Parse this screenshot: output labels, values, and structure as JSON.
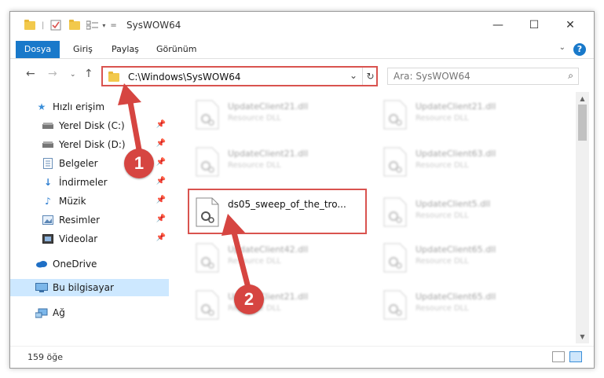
{
  "window": {
    "title": "SysWOW64"
  },
  "ribbon": {
    "file_tab": "Dosya",
    "tabs": [
      "Giriş",
      "Paylaş",
      "Görünüm"
    ],
    "help": "?"
  },
  "address": {
    "path": "C:\\Windows\\SysWOW64",
    "search_placeholder": "Ara: SysWOW64"
  },
  "sidebar": {
    "items": [
      {
        "label": "Hızlı erişim",
        "icon": "star-icon"
      },
      {
        "label": "Yerel Disk (C:)",
        "icon": "drive-icon",
        "pinned": true
      },
      {
        "label": "Yerel Disk (D:)",
        "icon": "drive-icon",
        "pinned": true
      },
      {
        "label": "Belgeler",
        "icon": "document-icon",
        "pinned": true
      },
      {
        "label": "İndirmeler",
        "icon": "download-icon",
        "pinned": true
      },
      {
        "label": "Müzik",
        "icon": "music-icon",
        "pinned": true
      },
      {
        "label": "Resimler",
        "icon": "pictures-icon",
        "pinned": true
      },
      {
        "label": "Videolar",
        "icon": "video-icon",
        "pinned": true
      },
      {
        "label": "OneDrive",
        "icon": "cloud-icon"
      },
      {
        "label": "Bu bilgisayar",
        "icon": "computer-icon",
        "selected": true
      },
      {
        "label": "Ağ",
        "icon": "network-icon"
      }
    ]
  },
  "files": {
    "left_column": [
      {
        "name": "UpdateClient21.dll",
        "desc": "Resource DLL"
      },
      {
        "name": "UpdateClient21.dll",
        "desc": "Resource DLL"
      },
      {
        "name": "ds05_sweep_of_the_tro...",
        "desc": "",
        "highlighted": true
      },
      {
        "name": "UpdateClient42.dll",
        "desc": "Resource DLL"
      },
      {
        "name": "UpdateClient21.dll",
        "desc": "Resource DLL"
      }
    ],
    "right_column": [
      {
        "name": "UpdateClient21.dll",
        "desc": "Resource DLL"
      },
      {
        "name": "UpdateClient63.dll",
        "desc": "Resource DLL"
      },
      {
        "name": "UpdateClient5.dll",
        "desc": "Resource DLL"
      },
      {
        "name": "UpdateClient65.dll",
        "desc": "Resource DLL"
      },
      {
        "name": "UpdateClient65.dll",
        "desc": "Resource DLL"
      }
    ]
  },
  "status": {
    "count": "159 öğe"
  },
  "steps": {
    "one": "1",
    "two": "2"
  },
  "colors": {
    "accent": "#1979ca",
    "highlight": "#d9534f",
    "badge": "#d64541",
    "selection": "#cde8ff"
  }
}
